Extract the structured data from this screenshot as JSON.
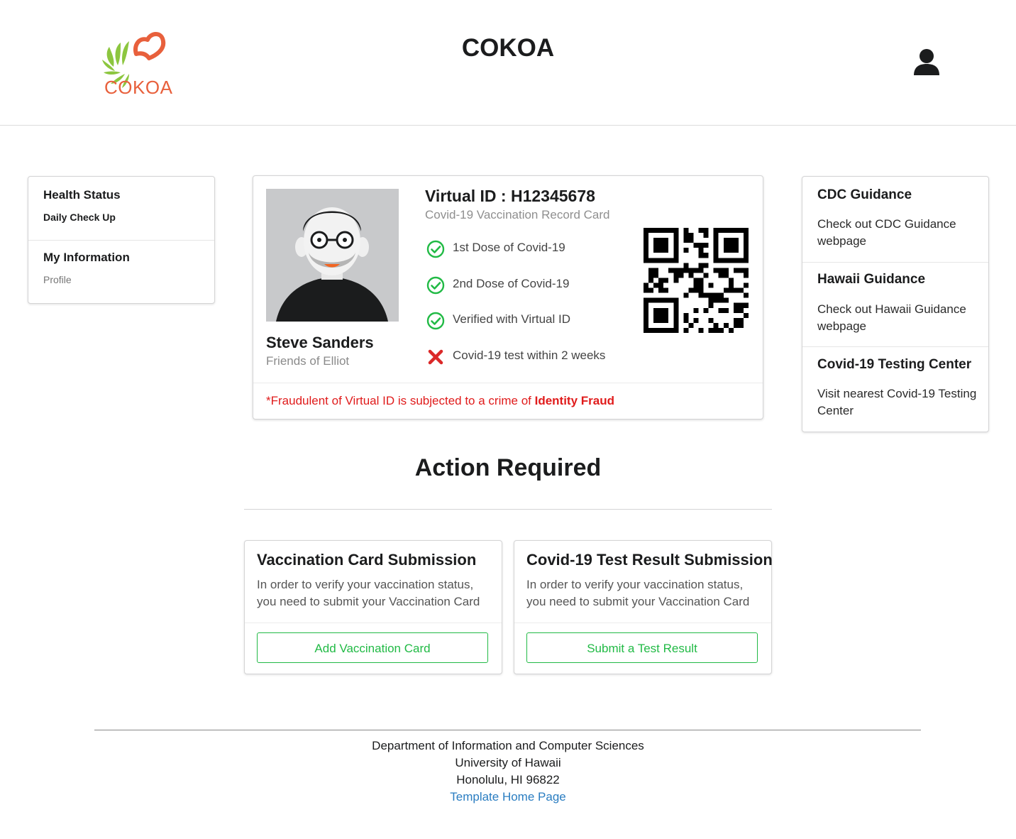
{
  "header": {
    "logo_text": "COKOA",
    "title": "COKOA",
    "user_icon": "user-icon"
  },
  "left_menu": {
    "items": [
      {
        "label": "Health Status",
        "sub": "Daily Check Up"
      },
      {
        "label": "My Information",
        "sub": "Profile"
      }
    ]
  },
  "id_card": {
    "name": "Steve Sanders",
    "group": "Friends of Elliot",
    "virtual_id": "Virtual ID : H12345678",
    "record_label": "Covid-19 Vaccination Record Card",
    "checks": [
      {
        "label": "1st Dose of Covid-19",
        "status": "done"
      },
      {
        "label": "2nd Dose of Covid-19",
        "status": "done"
      },
      {
        "label": "Verified with Virtual ID",
        "status": "done"
      },
      {
        "label": "Covid-19 test within 2 weeks",
        "status": "missing"
      }
    ],
    "warning_prefix": "*Fraudulent of Virtual ID is subjected to a crime of ",
    "warning_emphasis": "Identity Fraud",
    "colors": {
      "ok": "#21ba45",
      "fail": "#db2828",
      "warning": "#e01b1b"
    }
  },
  "guidance": {
    "sections": [
      {
        "title": "CDC Guidance",
        "text": "Check out CDC Guidance webpage"
      },
      {
        "title": "Hawaii Guidance",
        "text": "Check out Hawaii Guidance webpage"
      },
      {
        "title": "Covid-19 Testing Center",
        "text": "Visit nearest Covid-19 Testing Center"
      }
    ]
  },
  "action": {
    "title": "Action Required",
    "cards": [
      {
        "title": "Vaccination Card Submission",
        "desc": "In order to verify your vaccination status, you need to submit your Vaccination Card",
        "button": "Add Vaccination Card"
      },
      {
        "title": "Covid-19 Test Result Submission",
        "desc": "In order to verify your vaccination status, you need to submit your Vaccination Card",
        "button": "Submit a Test Result"
      }
    ]
  },
  "footer": {
    "line1": "Department of Information and Computer Sciences",
    "line2": "University of Hawaii",
    "line3": "Honolulu, HI 96822",
    "link": "Template Home Page",
    "link_color": "#2a7dc1"
  }
}
